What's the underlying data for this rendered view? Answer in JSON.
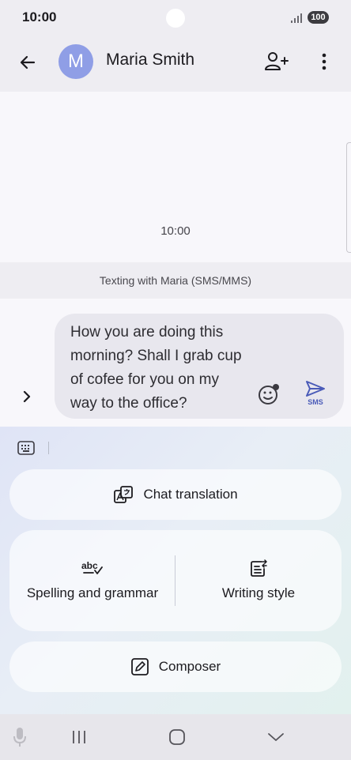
{
  "status_bar": {
    "time": "10:00",
    "battery": "100"
  },
  "header": {
    "avatar_letter": "M",
    "contact_name": "Maria Smith",
    "icons": [
      "back-arrow-icon",
      "add-contact-icon",
      "more-vert-icon"
    ]
  },
  "chat": {
    "timestamp": "10:00",
    "texting_banner": "Texting with Maria (SMS/MMS)"
  },
  "composer": {
    "message_text": "How you are doing this morning? Shall I grab cup of cofee for you on my way to the office?",
    "send_label": "SMS",
    "icons": [
      "expand-chevron-icon",
      "emoji-icon",
      "send-icon"
    ]
  },
  "ai_panel": {
    "chat_translation": "Chat translation",
    "spelling_grammar": "Spelling and grammar",
    "spelling_icon_text": "abc",
    "writing_style": "Writing style",
    "composer": "Composer",
    "icons": [
      "keyboard-icon",
      "translate-icon",
      "spellcheck-icon",
      "writing-style-icon",
      "composer-icon"
    ]
  },
  "nav_bar": {
    "icons": [
      "microphone-icon",
      "recents-icon",
      "home-icon",
      "hide-keyboard-icon"
    ]
  },
  "colors": {
    "avatar": "#8f9ee6",
    "send_accent": "#4a5bb8",
    "message_bubble": "#e8e7ee"
  }
}
